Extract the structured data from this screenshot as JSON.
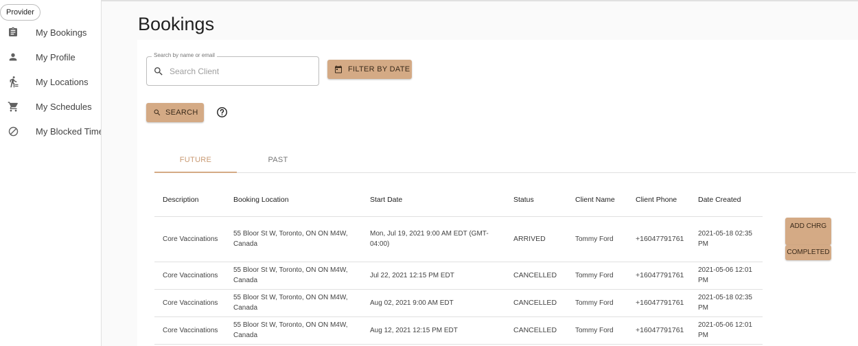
{
  "sidebar": {
    "role_chip": "Provider",
    "items": [
      {
        "label": "My Bookings",
        "icon": "clipboard-icon"
      },
      {
        "label": "My Profile",
        "icon": "person-icon"
      },
      {
        "label": "My Locations",
        "icon": "walking-person-icon"
      },
      {
        "label": "My Schedules",
        "icon": "cart-icon"
      },
      {
        "label": "My Blocked Times",
        "icon": "block-icon"
      }
    ]
  },
  "page": {
    "title": "Bookings"
  },
  "search": {
    "legend": "Search by name or email",
    "placeholder": "Search Client",
    "value": ""
  },
  "buttons": {
    "filter_by_date": "FILTER BY DATE",
    "search": "SEARCH"
  },
  "tabs": [
    {
      "label": "FUTURE",
      "active": true
    },
    {
      "label": "PAST",
      "active": false
    }
  ],
  "table": {
    "headers": {
      "description": "Description",
      "location": "Booking Location",
      "start": "Start Date",
      "status": "Status",
      "client_name": "Client Name",
      "phone": "Client Phone",
      "created": "Date Created"
    },
    "rows": [
      {
        "description": "Core Vaccinations",
        "location": "55 Bloor St W, Toronto, ON ON M4W, Canada",
        "start": "Mon, Jul 19, 2021 9:00 AM EDT (GMT-04:00)",
        "status": "ARRIVED",
        "client_name": "Tommy Ford",
        "phone": "+16047791761",
        "created": "2021-05-18 02:35 PM"
      },
      {
        "description": "Core Vaccinations",
        "location": "55 Bloor St W, Toronto, ON ON M4W, Canada",
        "start": "Jul 22, 2021 12:15 PM EDT",
        "status": "CANCELLED",
        "client_name": "Tommy Ford",
        "phone": "+16047791761",
        "created": "2021-05-06 12:01 PM"
      },
      {
        "description": "Core Vaccinations",
        "location": "55 Bloor St W, Toronto, ON ON M4W, Canada",
        "start": "Aug 02, 2021 9:00 AM EDT",
        "status": "CANCELLED",
        "client_name": "Tommy Ford",
        "phone": "+16047791761",
        "created": "2021-05-18 02:35 PM"
      },
      {
        "description": "Core Vaccinations",
        "location": "55 Bloor St W, Toronto, ON ON M4W, Canada",
        "start": "Aug 12, 2021 12:15 PM EDT",
        "status": "CANCELLED",
        "client_name": "Tommy Ford",
        "phone": "+16047791761",
        "created": "2021-05-06 12:01 PM"
      }
    ],
    "row_actions": {
      "add_charge": "ADD CHRG",
      "completed": "COMPLETED"
    }
  },
  "colors": {
    "accent": "#d4aa85",
    "active_tab_text": "#c99a73"
  }
}
